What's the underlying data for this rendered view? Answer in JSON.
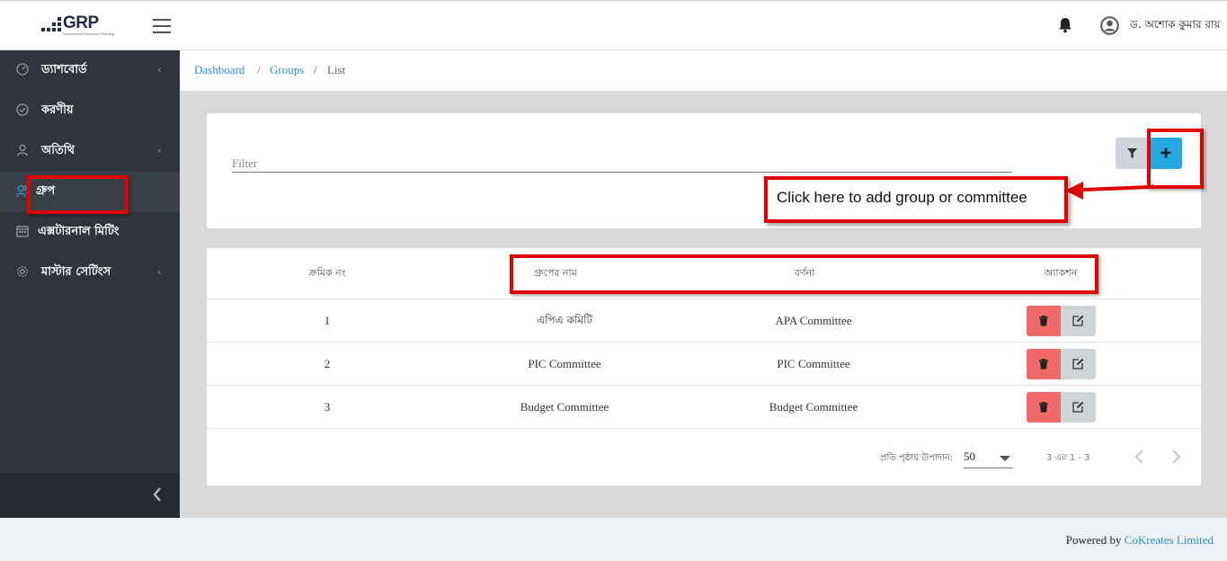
{
  "header": {
    "logo_text": "GRP",
    "logo_subtext": "Government Resource Planning",
    "user_name": "ড. অশোক কুমার রায়"
  },
  "sidebar": {
    "items": [
      {
        "label": "ড্যাশবোর্ড",
        "icon": "speedometer-icon",
        "has_chevron": true
      },
      {
        "label": "করণীয়",
        "icon": "check-circle-icon",
        "has_chevron": false
      },
      {
        "label": "অতিথি",
        "icon": "user-icon",
        "has_chevron": true
      },
      {
        "label": "গ্রুপ",
        "icon": "users-icon",
        "has_chevron": false,
        "active": true
      },
      {
        "label": "এক্সটারনাল মিটিং",
        "icon": "calendar-icon",
        "has_chevron": false
      },
      {
        "label": "মাস্টার সেটিংস",
        "icon": "gear-icon",
        "has_chevron": true
      }
    ],
    "chevron": "‹"
  },
  "breadcrumb": {
    "items": [
      "Dashboard",
      "Groups",
      "List"
    ],
    "separator": "/"
  },
  "filter": {
    "placeholder": "Filter"
  },
  "table": {
    "headers": [
      "ক্রমিক নং",
      "গ্রুপের নাম",
      "বর্ণনা",
      "অ্যাকশন"
    ],
    "rows": [
      {
        "serial": "1",
        "name": "এপিএ কমিটি",
        "description": "APA Committee"
      },
      {
        "serial": "2",
        "name": "PIC Committee",
        "description": "PIC Committee"
      },
      {
        "serial": "3",
        "name": "Budget Committee",
        "description": "Budget Committee"
      }
    ],
    "per_page_label": "প্রতি পৃষ্ঠায় উপাদান:",
    "per_page_value": "50",
    "range_text": "3 এর 1 - 3"
  },
  "annotation": {
    "callout_text": "Click here to add group or committee"
  },
  "footer": {
    "powered_by": "Powered by",
    "company": "CoKreates Limited"
  },
  "colors": {
    "accent": "#26a9e0",
    "sidebar_bg": "#2f343d",
    "delete": "#f16a6a",
    "link": "#2b8fc7",
    "annotation": "#e00000"
  }
}
